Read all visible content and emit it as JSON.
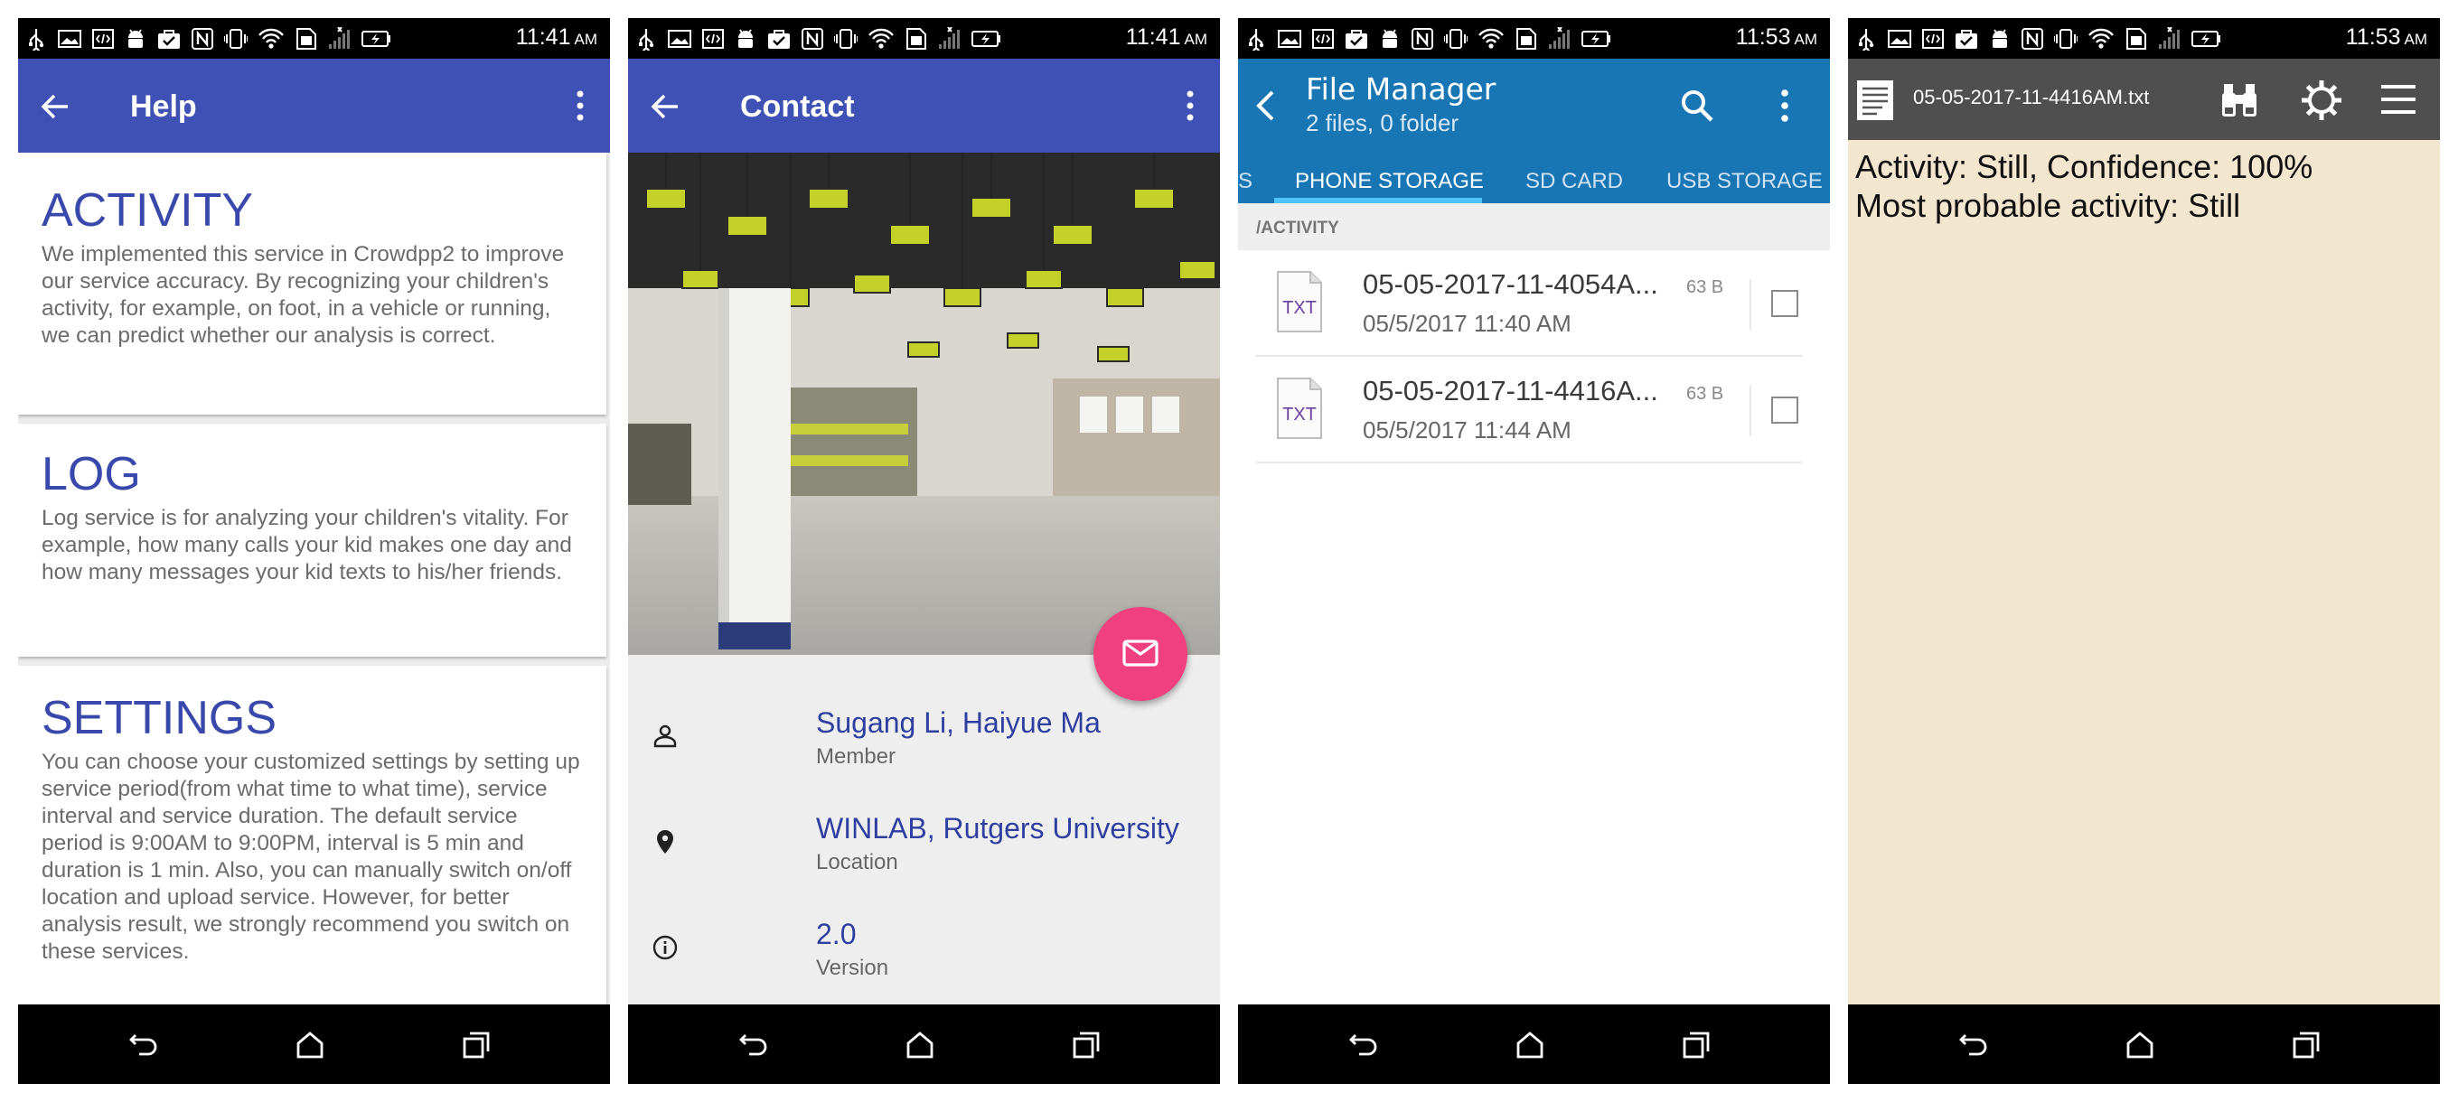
{
  "status_bars": {
    "p1": {
      "time": "11:41",
      "ampm": "AM"
    },
    "p2": {
      "time": "11:41",
      "ampm": "AM"
    },
    "p3": {
      "time": "11:53",
      "ampm": "AM"
    },
    "p4": {
      "time": "11:53",
      "ampm": "AM"
    }
  },
  "help": {
    "title": "Help",
    "sections": [
      {
        "heading": "ACTIVITY",
        "body": "We implemented this service in Crowdpp2 to improve our service accuracy. By recognizing your children's activity, for example, on foot, in a vehicle or running, we can predict whether our analysis is correct."
      },
      {
        "heading": "LOG",
        "body": "Log service is for analyzing your children's vitality. For example, how many calls your kid makes one day and how many messages your kid texts to his/her friends."
      },
      {
        "heading": "SETTINGS",
        "body": "You can choose your customized settings by setting up service period(from what time to what time), service interval and service duration. The default service period is 9:00AM to 9:00PM, interval is 5 min and duration is 1 min. Also, you can manually switch on/off location and upload service. However, for better analysis result, we strongly recommend you switch on these services."
      }
    ]
  },
  "contact": {
    "title": "Contact",
    "rows": [
      {
        "value": "Sugang Li, Haiyue Ma",
        "label": "Member",
        "icon": "person-icon"
      },
      {
        "value": "WINLAB, Rutgers University",
        "label": "Location",
        "icon": "location-pin-icon"
      },
      {
        "value": "2.0",
        "label": "Version",
        "icon": "info-icon"
      }
    ]
  },
  "file_manager": {
    "title": "File Manager",
    "subtitle": "2 files, 0 folder",
    "tabs": {
      "partial": "S",
      "phone": "PHONE STORAGE",
      "sd": "SD CARD",
      "usb": "USB STORAGE"
    },
    "path": "/ACTIVITY",
    "files": [
      {
        "name": "05-05-2017-11-4054A...",
        "date": "05/5/2017 11:40 AM",
        "size": "63 B",
        "icon_text": "TXT"
      },
      {
        "name": "05-05-2017-11-4416A...",
        "date": "05/5/2017 11:44 AM",
        "size": "63 B",
        "icon_text": "TXT"
      }
    ]
  },
  "text_viewer": {
    "filename": "05-05-2017-11-4416AM.txt",
    "lines": [
      "Activity: Still, Confidence: 100%",
      "Most probable activity: Still"
    ]
  },
  "colors": {
    "indigo": "#3f51b5",
    "fm_blue": "#1976b4",
    "fab_pink": "#f0407e",
    "note_bg": "#f3e6cf"
  }
}
